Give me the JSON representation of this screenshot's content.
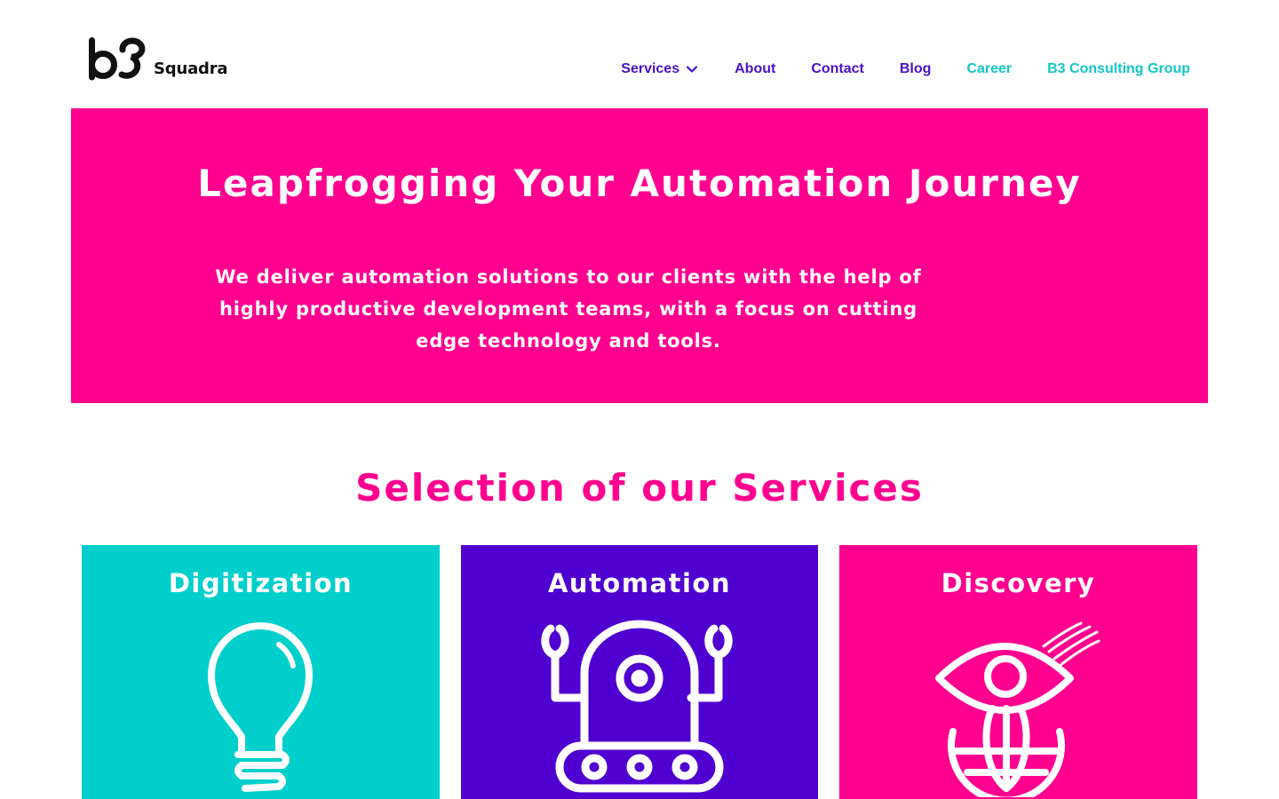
{
  "brand": {
    "logo_mark": "b3",
    "logo_word": "Squadra"
  },
  "nav": {
    "items": [
      {
        "label": "Services",
        "has_dropdown": true,
        "color": "#4a10c9"
      },
      {
        "label": "About",
        "color": "#4a10c9"
      },
      {
        "label": "Contact",
        "color": "#4a10c9"
      },
      {
        "label": "Blog",
        "color": "#4a10c9"
      },
      {
        "label": "Career",
        "color": "#12c7c4"
      },
      {
        "label": "B3 Consulting Group",
        "color": "#12c7c4"
      }
    ]
  },
  "hero": {
    "title": "Leapfrogging Your Automation Journey",
    "subtitle": "We deliver automation solutions to our clients with the help of highly productive development teams, with a focus on cutting edge technology and tools.",
    "background": "#ff008f"
  },
  "services": {
    "title": "Selection of our Services",
    "cards": [
      {
        "title": "Digitization",
        "icon": "lightbulb-icon",
        "color": "#00cfcb"
      },
      {
        "title": "Automation",
        "icon": "robot-icon",
        "color": "#4f00d0"
      },
      {
        "title": "Discovery",
        "icon": "eye-globe-icon",
        "color": "#ff008f"
      }
    ]
  },
  "colors": {
    "brand_pink": "#ff008f",
    "brand_purple": "#4a10c9",
    "brand_teal": "#12c7c4"
  }
}
